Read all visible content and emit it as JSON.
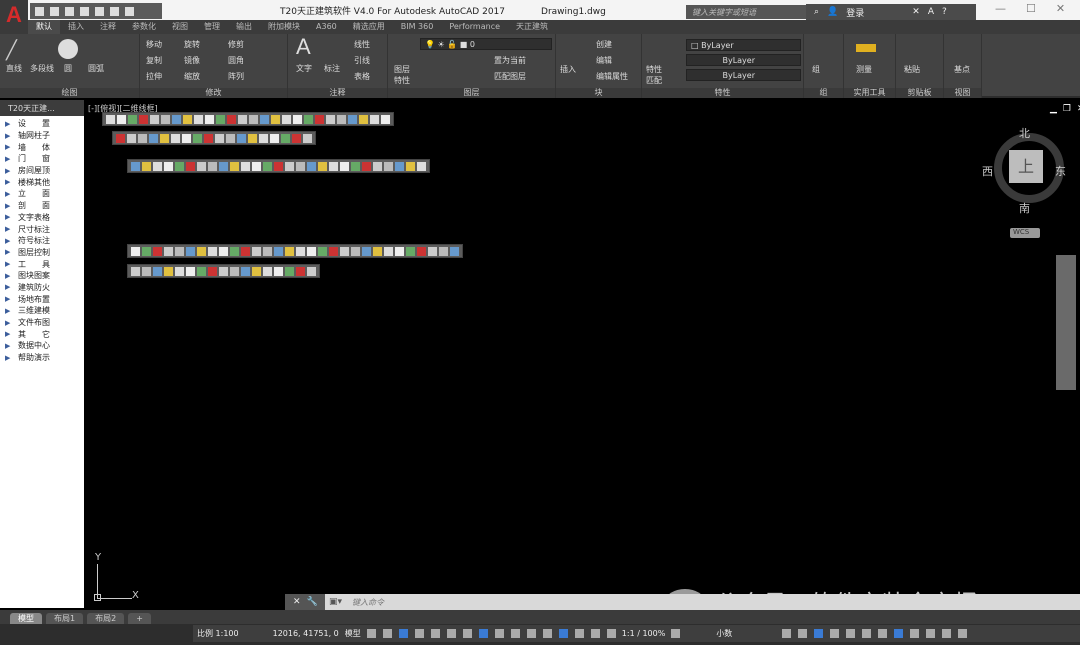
{
  "app": {
    "logo": "A",
    "title": "T20天正建筑软件 V4.0 For Autodesk AutoCAD 2017",
    "document": "Drawing1.dwg",
    "search_placeholder": "键入关键字或短语",
    "signin": "登录",
    "help": "?"
  },
  "tabs": [
    "默认",
    "插入",
    "注释",
    "参数化",
    "视图",
    "管理",
    "输出",
    "附加模块",
    "A360",
    "精选应用",
    "BIM 360",
    "Performance",
    "天正建筑"
  ],
  "active_tab": "默认",
  "ribbon": {
    "draw": {
      "label": "绘图",
      "items": [
        "直线",
        "多段线",
        "圆",
        "圆弧"
      ]
    },
    "modify": {
      "label": "修改",
      "items": [
        "移动",
        "旋转",
        "修剪",
        "复制",
        "镜像",
        "圆角",
        "拉伸",
        "缩放",
        "阵列"
      ]
    },
    "annotation": {
      "label": "注释",
      "items": [
        "文字",
        "标注",
        "线性",
        "引线",
        "表格"
      ]
    },
    "layers": {
      "label": "图层",
      "items": [
        "图层特性",
        "置为当前",
        "匹配图层"
      ],
      "current_layer": "0"
    },
    "block": {
      "label": "块",
      "items": [
        "插入",
        "创建",
        "编辑",
        "编辑属性"
      ]
    },
    "properties": {
      "label": "特性",
      "match": "特性匹配",
      "color": "ByLayer",
      "linetype": "ByLayer",
      "lineweight": "ByLayer"
    },
    "groups": {
      "label": "组",
      "items": [
        "组"
      ]
    },
    "utilities": {
      "label": "实用工具",
      "items": [
        "测量"
      ]
    },
    "clipboard": {
      "label": "剪贴板",
      "items": [
        "粘贴"
      ]
    },
    "view": {
      "label": "视图",
      "items": [
        "基点"
      ]
    }
  },
  "left_panel": {
    "title": "T20天正建...",
    "items": [
      "设　　置",
      "轴网柱子",
      "墙　　体",
      "门　　窗",
      "房间屋顶",
      "楼梯其他",
      "立　　面",
      "剖　　面",
      "文字表格",
      "尺寸标注",
      "符号标注",
      "图层控制",
      "工　　具",
      "图块图案",
      "建筑防火",
      "场地布置",
      "三维建模",
      "文件布图",
      "其　　它",
      "数据中心",
      "帮助演示"
    ]
  },
  "viewport": {
    "label": "[-][俯视][二维线框]"
  },
  "viewcube": {
    "north": "北",
    "south": "南",
    "east": "东",
    "west": "西",
    "face": "上",
    "wcs": "WCS"
  },
  "ucs": {
    "x": "X",
    "y": "Y"
  },
  "command": {
    "placeholder": "键入命令"
  },
  "watermark": "公众号 · 软件安装全家桶",
  "layout_tabs": [
    "模型",
    "布局1",
    "布局2",
    "+"
  ],
  "status": {
    "scale": "比例 1:100",
    "coords": "12016, 41751, 0",
    "model": "模型",
    "annoscale": "1:1 / 100%",
    "units": "小数"
  }
}
